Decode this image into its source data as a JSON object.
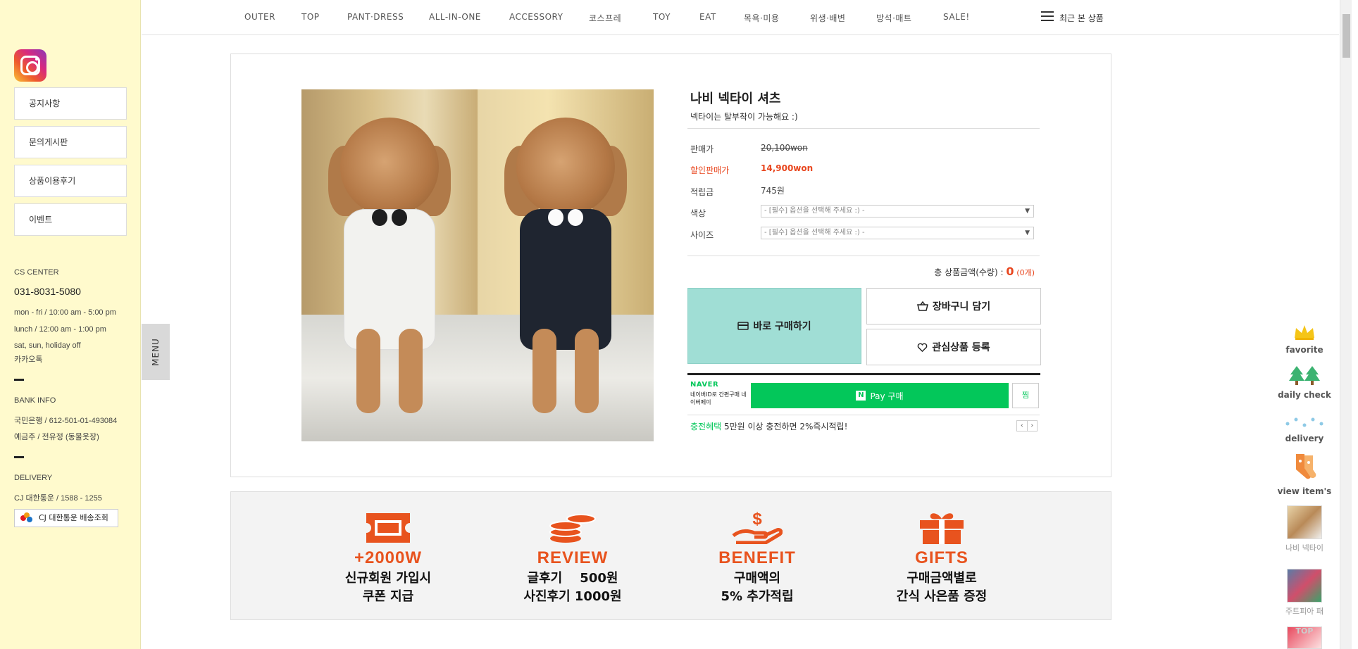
{
  "sidebar": {
    "links": [
      "공지사항",
      "문의게시판",
      "상품이용후기",
      "이벤트"
    ],
    "cs_title": "CS CENTER",
    "cs_phone": "031-8031-5080",
    "cs_hours": [
      "mon - fri / 10:00 am - 5:00 pm",
      "lunch / 12:00 am - 1:00 pm",
      "sat, sun, holiday off"
    ],
    "kakao": "카카오톡",
    "bank_title": "BANK INFO",
    "bank_account": "국민은행 / 612-501-01-493084",
    "bank_holder": "예금주 / 전유정 (동물옷장)",
    "delivery_title": "DELIVERY",
    "delivery_company": "CJ 대한통운 / 1588 - 1255",
    "delivery_track_button": "CJ 대한통운 배송조회"
  },
  "menu_tab": "MENU",
  "nav": {
    "items": [
      "OUTER",
      "TOP",
      "PANT·DRESS",
      "ALL-IN-ONE",
      "ACCESSORY",
      "코스프레",
      "TOY",
      "EAT",
      "목욕·미용",
      "위생·배변",
      "방석·매트",
      "SALE!"
    ],
    "recent": "최근 본 상품"
  },
  "product": {
    "title": "나비 넥타이 셔츠",
    "subtitle": "넥타이는 탈부착이 가능해요 :)",
    "price_label": "판매가",
    "price": "20,100won",
    "sale_label": "할인판매가",
    "sale_price": "14,900won",
    "points_label": "적립금",
    "points": "745원",
    "color_label": "색상",
    "size_label": "사이즈",
    "option_placeholder": "- [필수] 옵션을 선택해 주세요 :) -",
    "total_label": "총 상품금액(수량) : ",
    "total_value": "0",
    "total_qty": "(0개)",
    "buy_now": "바로 구매하기",
    "add_cart": "장바구니 담기",
    "wishlist": "관심상품 등록",
    "naver_logo": "NAVER",
    "naver_desc": "네이버ID로 간편구매 네이버페이",
    "npay_n": "N",
    "npay_label": "Pay 구매",
    "zzim": "찜",
    "promo_highlight": "충전혜택",
    "promo_text": " 5만원 이상 충전하면 2%즉시적립!",
    "pager_prev": "‹",
    "pager_next": "›"
  },
  "benefits": [
    {
      "head": "+2000W",
      "line1": "신규회원 가입시",
      "line2": "쿠폰 지급",
      "icon": "coupon-icon"
    },
    {
      "head": "REVIEW",
      "line1": "글후기    500원",
      "line2": "사진후기 1000원",
      "icon": "coins-icon"
    },
    {
      "head": "BENEFIT",
      "line1": "구매액의",
      "line2": "5% 추가적립",
      "icon": "money-hand-icon"
    },
    {
      "head": "GIFTS",
      "line1": "구매금액별로",
      "line2": "간식 사은품 증정",
      "icon": "gift-icon"
    }
  ],
  "quick": {
    "favorite": "favorite",
    "daily": "daily check",
    "delivery": "delivery",
    "view": "view item's",
    "recent1": "나비 넥타이",
    "recent2": "주트피아 패",
    "top": "TOP"
  },
  "colors": {
    "accent": "#e8531e",
    "sale": "#e8461e",
    "buy": "#a0ded5",
    "naver": "#03c75a",
    "sidebar": "#fffacd"
  }
}
